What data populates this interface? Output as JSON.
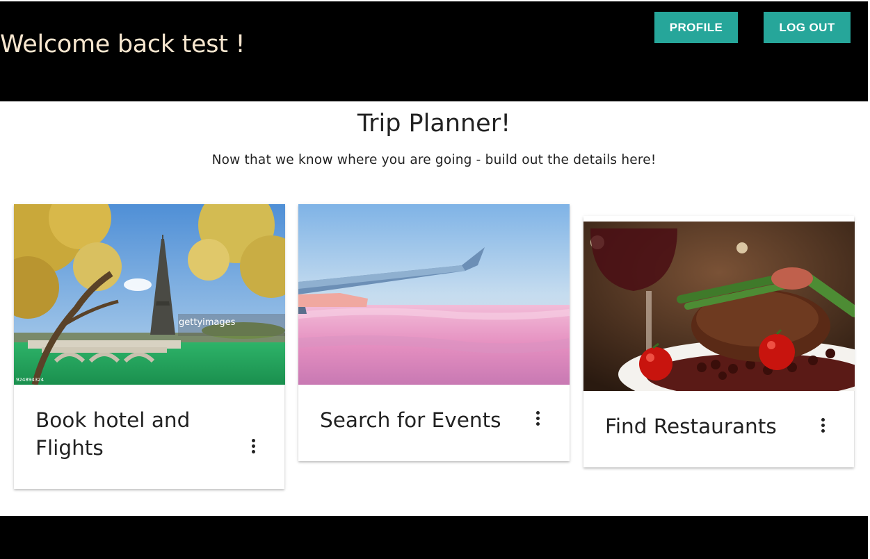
{
  "header": {
    "welcome": "Welcome back test !",
    "profile_label": "PROFILE",
    "logout_label": "LOG OUT"
  },
  "main": {
    "title": "Trip Planner!",
    "subtitle": "Now that we know where you are going - build out the details here!"
  },
  "cards": [
    {
      "title_line1": "Book hotel and",
      "title_line2": "Flights",
      "watermark": "gettyimages",
      "photo_id": "924894324"
    },
    {
      "title": "Search for Events"
    },
    {
      "title": "Find Restaurants"
    }
  ],
  "colors": {
    "header_bg": "#000000",
    "welcome_text": "#f7e6cf",
    "button_bg": "#26a69a",
    "footer_bg": "#000000"
  },
  "icons": {
    "card_menu": "more-vert-icon"
  }
}
